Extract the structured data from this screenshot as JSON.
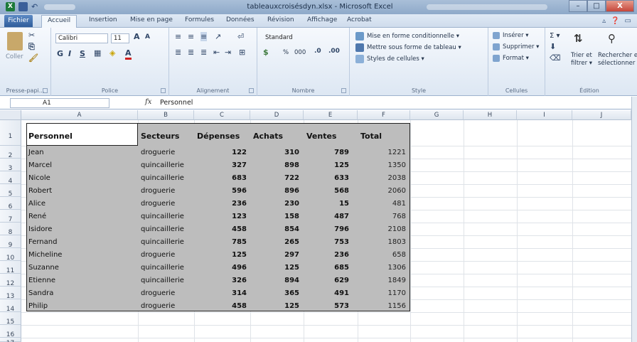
{
  "window": {
    "title": "tableauxcroisésdyn.xlsx - Microsoft Excel",
    "minimize": "–",
    "maximize": "□",
    "close": "X"
  },
  "tabs": [
    "Fichier",
    "Accueil",
    "Insertion",
    "Mise en page",
    "Formules",
    "Données",
    "Révision",
    "Affichage",
    "Acrobat"
  ],
  "active_tab": "Accueil",
  "ribbon": {
    "clipboard": {
      "paste": "Coller",
      "label": "Presse-papi..."
    },
    "font": {
      "name": "Calibri",
      "size": "11",
      "bold": "G",
      "italic": "I",
      "underline": "S",
      "grow": "A",
      "shrink": "A",
      "color_a": "A",
      "label": "Police"
    },
    "alignment": {
      "label": "Alignement"
    },
    "number": {
      "format": "Standard",
      "percent": "%",
      "thousands": "000",
      "label": "Nombre"
    },
    "styles": {
      "conditional": "Mise en forme conditionnelle ▾",
      "as_table": "Mettre sous forme de tableau ▾",
      "cell_styles": "Styles de cellules ▾",
      "label": "Style"
    },
    "cells": {
      "insert": "Insérer ▾",
      "delete": "Supprimer ▾",
      "format": "Format ▾",
      "label": "Cellules"
    },
    "editing": {
      "sigma": "Σ ▾",
      "sort": "Trier et",
      "filter": "filtrer ▾",
      "find": "Rechercher et",
      "select": "sélectionner ▾",
      "label": "Édition"
    }
  },
  "formula_bar": {
    "name_box": "A1",
    "fx": "fx",
    "value": "Personnel"
  },
  "columns": [
    "A",
    "B",
    "C",
    "D",
    "E",
    "F",
    "G",
    "H",
    "I",
    "J"
  ],
  "rows": [
    "1",
    "2",
    "3",
    "4",
    "5",
    "6",
    "7",
    "8",
    "9",
    "10",
    "11",
    "12",
    "13",
    "14",
    "15",
    "16",
    "17"
  ],
  "table": {
    "headers": [
      "Personnel",
      "Secteurs",
      "Dépenses",
      "Achats",
      "Ventes",
      "Total"
    ],
    "data": [
      [
        "Jean",
        "droguerie",
        "122",
        "310",
        "789",
        "1221"
      ],
      [
        "Marcel",
        "quincaillerie",
        "327",
        "898",
        "125",
        "1350"
      ],
      [
        "Nicole",
        "quincaillerie",
        "683",
        "722",
        "633",
        "2038"
      ],
      [
        "Robert",
        "droguerie",
        "596",
        "896",
        "568",
        "2060"
      ],
      [
        "Alice",
        "droguerie",
        "236",
        "230",
        "15",
        "481"
      ],
      [
        "René",
        "quincaillerie",
        "123",
        "158",
        "487",
        "768"
      ],
      [
        "Isidore",
        "quincaillerie",
        "458",
        "854",
        "796",
        "2108"
      ],
      [
        "Fernand",
        "quincaillerie",
        "785",
        "265",
        "753",
        "1803"
      ],
      [
        "Micheline",
        "droguerie",
        "125",
        "297",
        "236",
        "658"
      ],
      [
        "Suzanne",
        "quincaillerie",
        "496",
        "125",
        "685",
        "1306"
      ],
      [
        "Etienne",
        "quincaillerie",
        "326",
        "894",
        "629",
        "1849"
      ],
      [
        "Sandra",
        "droguerie",
        "314",
        "365",
        "491",
        "1170"
      ],
      [
        "Philip",
        "droguerie",
        "458",
        "125",
        "573",
        "1156"
      ]
    ]
  }
}
